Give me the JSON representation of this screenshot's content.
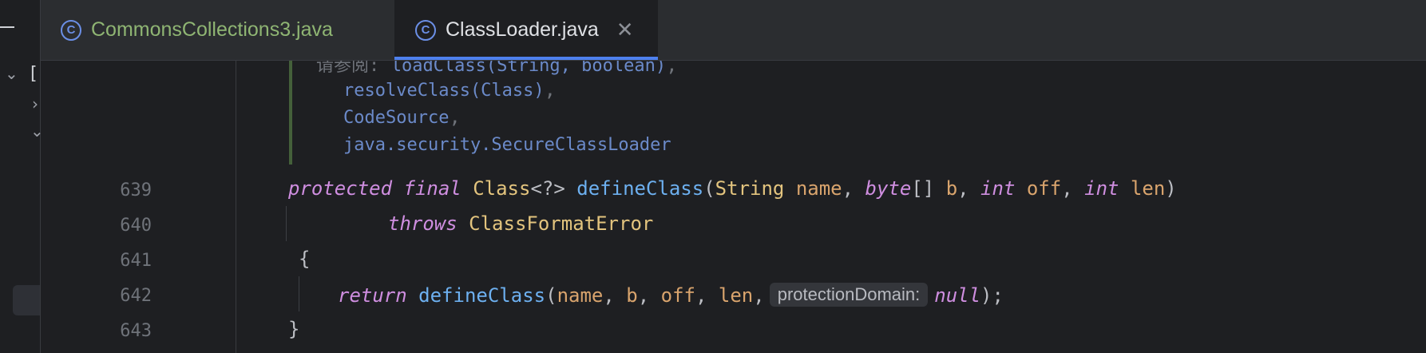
{
  "tabs": [
    {
      "label": "CommonsCollections3.java",
      "icon": "java-class-icon",
      "active": false
    },
    {
      "label": "ClassLoader.java",
      "icon": "java-class-icon",
      "active": true
    }
  ],
  "close_glyph": "✕",
  "doc": {
    "prefix": "请参阅:",
    "refs": [
      "loadClass(String, boolean)",
      "resolveClass(Class)",
      "CodeSource",
      "java.security.SecureClassLoader"
    ]
  },
  "line_numbers": [
    "639",
    "640",
    "641",
    "642",
    "643"
  ],
  "code": {
    "l639": {
      "k1": "protected",
      "k2": "final",
      "t1": "Class",
      "p1": "<?>",
      "f1": "defineClass",
      "p2": "(",
      "t2": "String",
      "a1": "name",
      "c1": ",",
      "k3": "byte",
      "p3": "[]",
      "a2": "b",
      "c2": ",",
      "k4": "int",
      "a3": "off",
      "c3": ",",
      "k5": "int",
      "a4": "len",
      "p4": ")"
    },
    "l640": {
      "k1": "throws",
      "t1": "ClassFormatError"
    },
    "l641": {
      "p1": "{"
    },
    "l642": {
      "k1": "return",
      "f1": "defineClass",
      "p1": "(",
      "a1": "name",
      "c1": ",",
      "a2": "b",
      "c2": ",",
      "a3": "off",
      "c3": ",",
      "a4": "len",
      "c4": ",",
      "hint": "protectionDomain:",
      "k2": "null",
      "p2": ");"
    },
    "l643": {
      "p1": "}"
    }
  },
  "colors": {
    "keyword": "#cf8ee0",
    "type": "#e3c47e",
    "function": "#6db0f0",
    "param": "#d9a46d",
    "doc_link": "#6b8ac9",
    "accent": "#4e80ee"
  }
}
